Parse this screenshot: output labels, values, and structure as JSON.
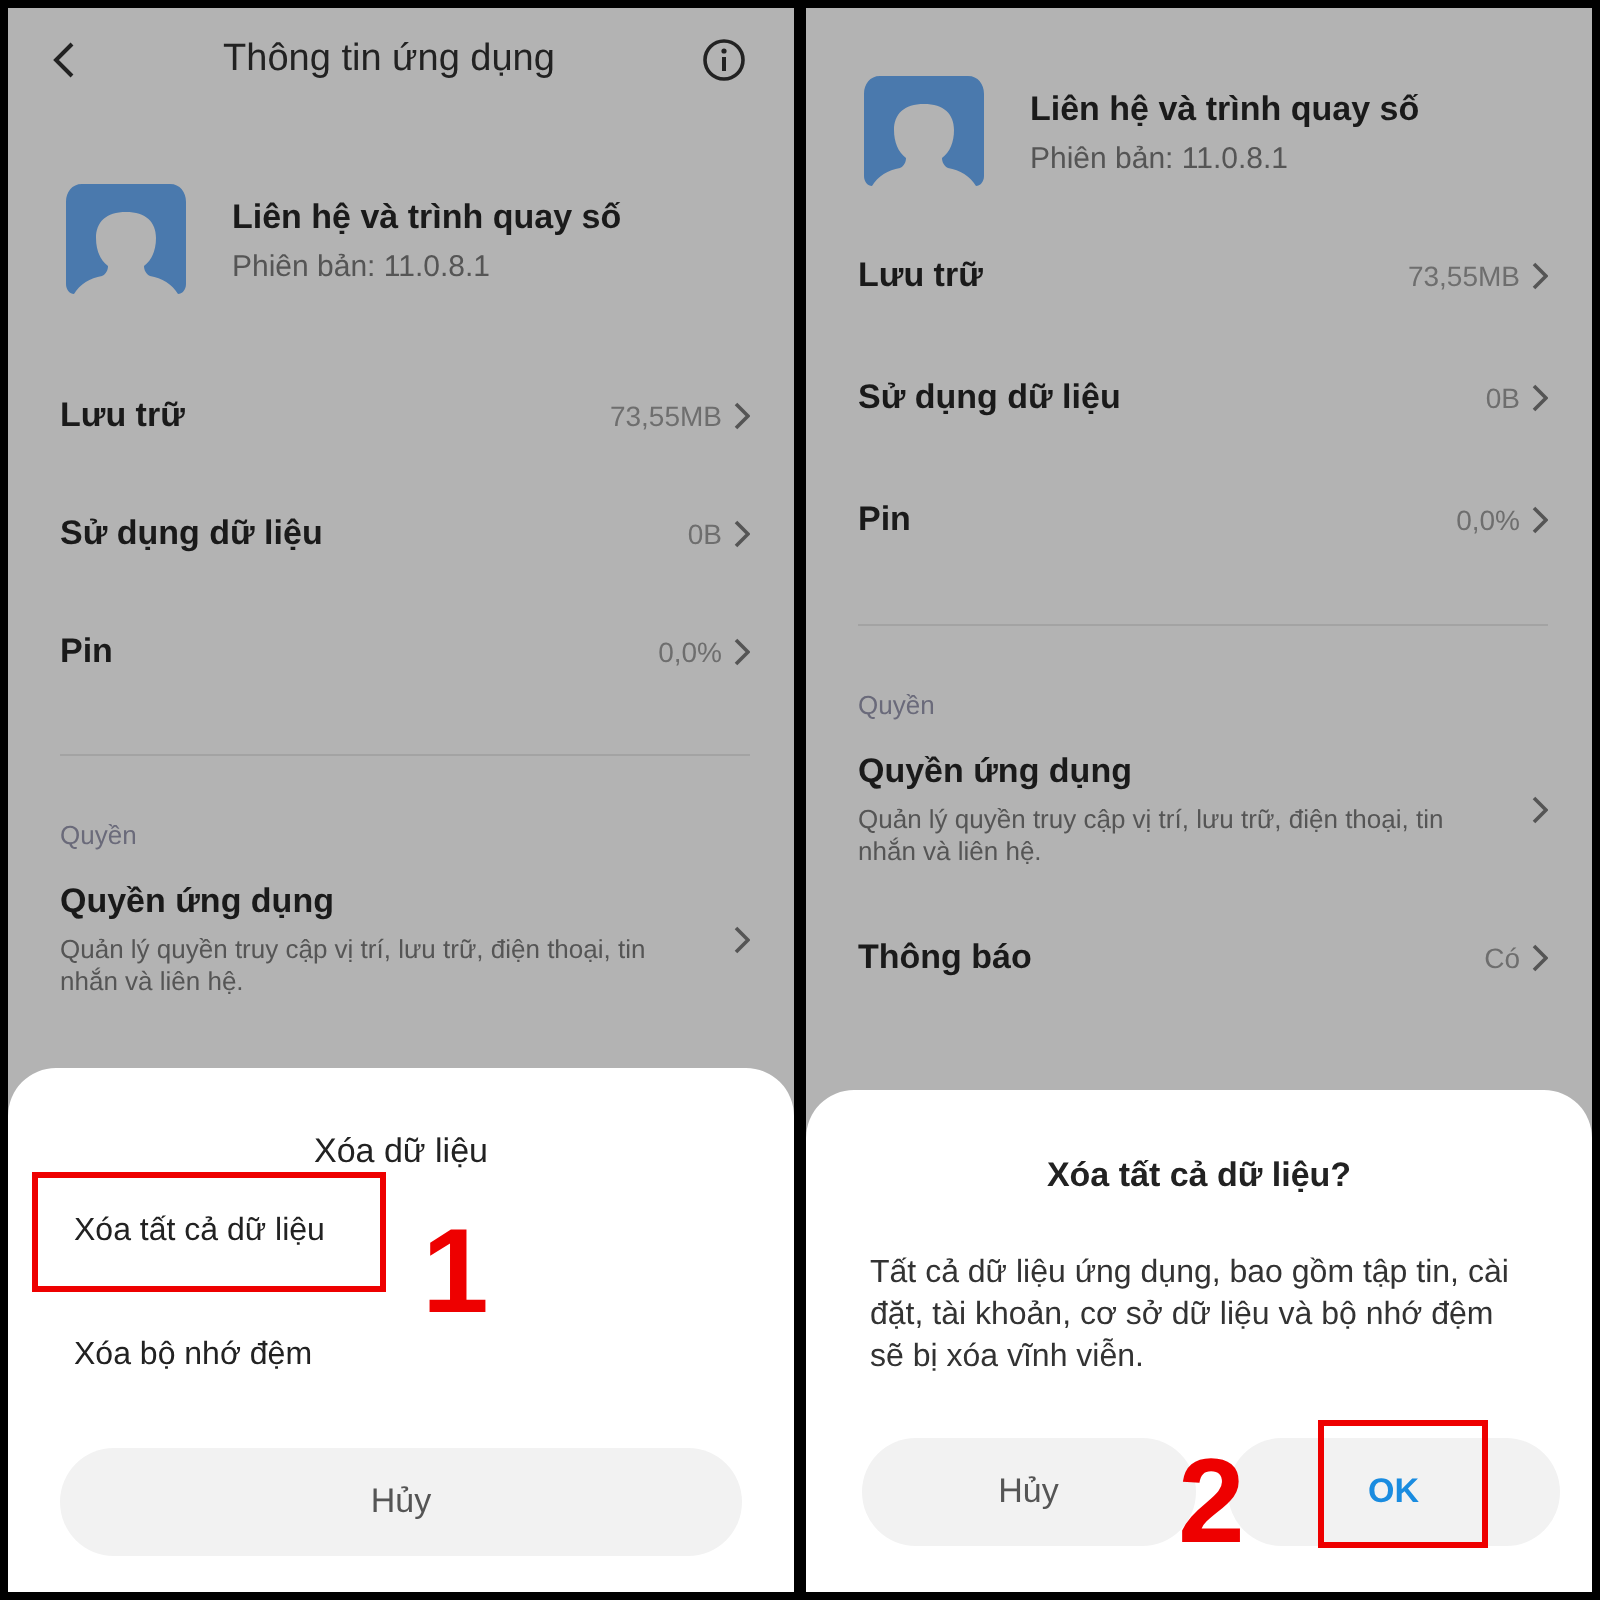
{
  "panels": [
    {
      "kind": "sheet",
      "top_bar": {
        "title": "Thông tin ứng dụng"
      },
      "app": {
        "name": "Liên hệ và trình quay số",
        "version": "Phiên bản: 11.0.8.1"
      },
      "rows": [
        {
          "label": "Lưu trữ",
          "value": "73,55MB"
        },
        {
          "label": "Sử dụng dữ liệu",
          "value": "0B"
        },
        {
          "label": "Pin",
          "value": "0,0%"
        }
      ],
      "section": "Quyền",
      "permission": {
        "title": "Quyền ứng dụng",
        "description": "Quản lý quyền truy cập vị trí, lưu trữ, điện thoại, tin nhắn và liên hệ."
      },
      "sheet": {
        "title": "Xóa dữ liệu",
        "options": [
          {
            "label": "Xóa tất cả dữ liệu",
            "highlighted": true
          },
          {
            "label": "Xóa bộ nhớ đệm",
            "highlighted": false
          }
        ],
        "cancel": "Hủy"
      },
      "step": "1"
    },
    {
      "kind": "dialog",
      "app": {
        "name": "Liên hệ và trình quay số",
        "version": "Phiên bản: 11.0.8.1"
      },
      "rows": [
        {
          "label": "Lưu trữ",
          "value": "73,55MB"
        },
        {
          "label": "Sử dụng dữ liệu",
          "value": "0B"
        },
        {
          "label": "Pin",
          "value": "0,0%"
        }
      ],
      "section": "Quyền",
      "permission": {
        "title": "Quyền ứng dụng",
        "description": "Quản lý quyền truy cập vị trí, lưu trữ, điện thoại, tin nhắn và liên hệ."
      },
      "extra_rows": [
        {
          "label": "Thông báo",
          "value": "Có"
        }
      ],
      "dialog": {
        "title": "Xóa tất cả dữ liệu?",
        "message": "Tất cả dữ liệu ứng dụng, bao gồm tập tin, cài đặt, tài khoản, cơ sở dữ liệu và bộ nhớ đệm sẽ bị xóa vĩnh viễn.",
        "buttons": [
          {
            "label": "Hủy",
            "kind": "cancel",
            "highlighted": false
          },
          {
            "label": "OK",
            "kind": "confirm",
            "highlighted": true
          }
        ]
      },
      "step": "2"
    }
  ]
}
